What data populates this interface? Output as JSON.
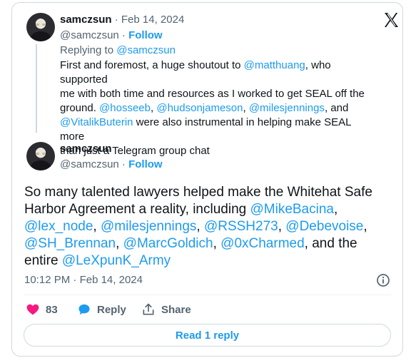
{
  "reply_tweet": {
    "display_name": "samczsun",
    "date": "Feb 14, 2024",
    "handle": "@samczsun",
    "follow_label": "Follow",
    "replying_to_label": "Replying to",
    "replying_to_handle": "@samczsun",
    "text": [
      [
        "First and foremost, a huge shoutout to ",
        "@matthuang",
        ", who supported"
      ],
      [
        "me with both time and resources as I worked to get SEAL off the"
      ],
      [
        "ground. ",
        "@hosseeb",
        ", ",
        "@hudsonjameson",
        ", ",
        "@milesjennings",
        ", and"
      ],
      [
        "@VitalikButerin",
        " were also instrumental in helping make SEAL more"
      ],
      [
        "than just a Telegram group chat"
      ]
    ]
  },
  "main_tweet": {
    "display_name": "samczsun",
    "handle": "@samczsun",
    "follow_label": "Follow",
    "text": "So many talented lawyers helped make the Whitehat Safe Harbor Agreement a reality, including @MikeBacina, @lex_node, @milesjennings, @RSSH273, @Debevoise, @SH_Brennan, @MarcGoldich, @0xCharmed, and the entire @LeXpunK_Army",
    "time": "10:12 PM",
    "date": "Feb 14, 2024",
    "likes": "83",
    "reply_label": "Reply",
    "share_label": "Share",
    "read_reply_label": "Read 1 reply"
  },
  "colors": {
    "link": "#1d9bf0",
    "like": "#f91880",
    "muted": "#536471"
  },
  "icons": [
    "x-logo-icon",
    "info-icon",
    "heart-icon",
    "reply-icon",
    "share-icon"
  ]
}
